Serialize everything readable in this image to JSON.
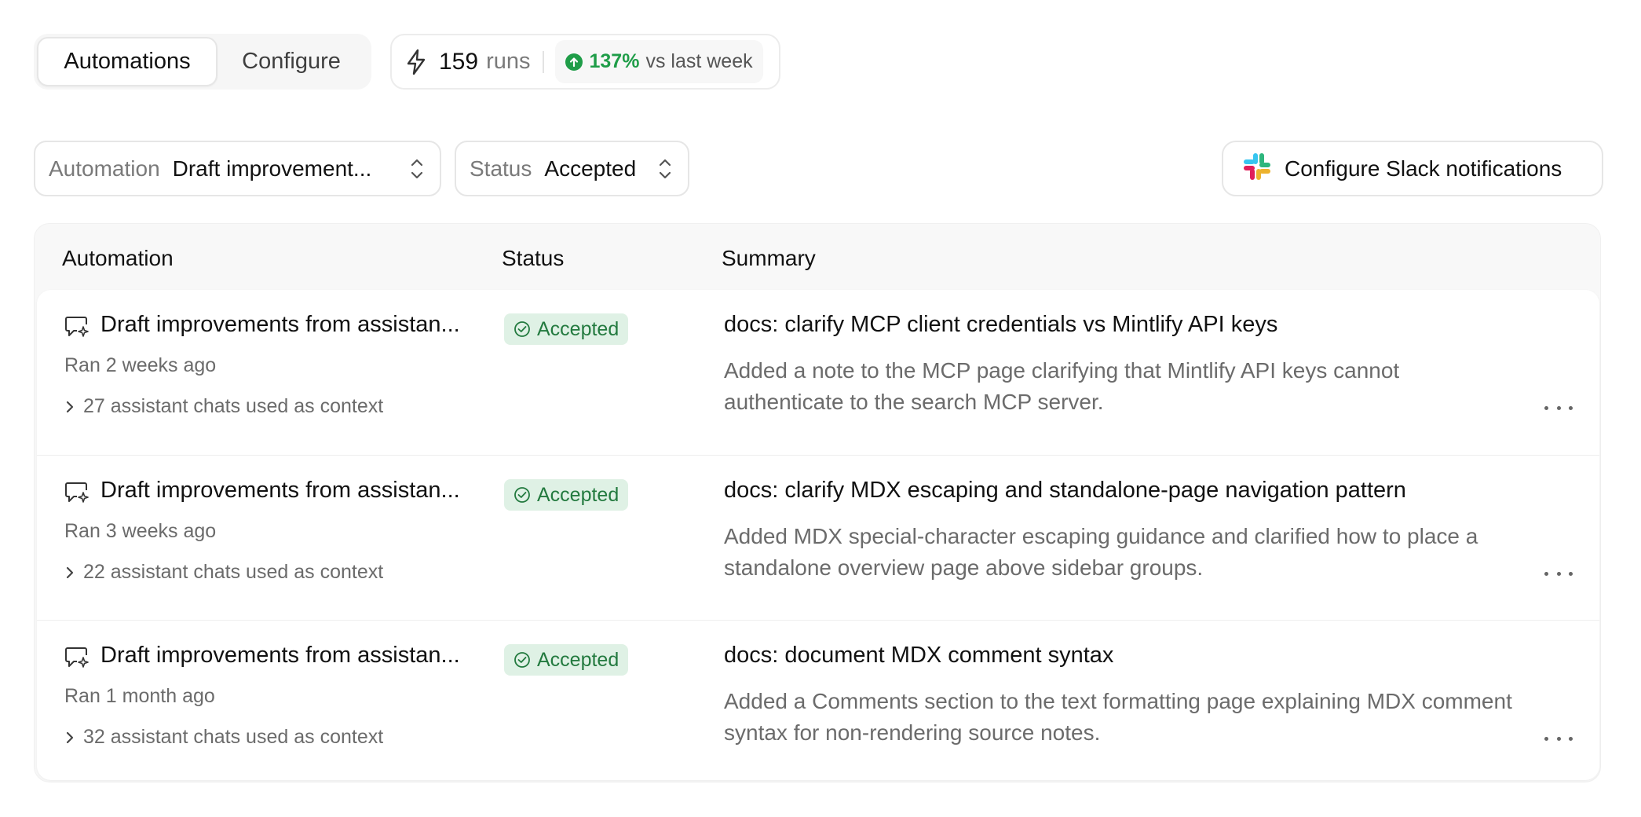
{
  "tabs": [
    {
      "label": "Automations",
      "active": true
    },
    {
      "label": "Configure",
      "active": false
    }
  ],
  "runs": {
    "count": "159",
    "unit": "runs",
    "change": "137%",
    "comparison": "vs last week",
    "trend_color": "#1f9d48"
  },
  "filters": {
    "automation": {
      "label": "Automation",
      "value": "Draft improvement..."
    },
    "status": {
      "label": "Status",
      "value": "Accepted"
    }
  },
  "slack_button": {
    "label": "Configure Slack notifications",
    "icon": "slack-icon"
  },
  "table": {
    "headers": {
      "automation": "Automation",
      "status": "Status",
      "summary": "Summary"
    },
    "rows": [
      {
        "automation": "Draft improvements from assistan...",
        "ran": "Ran 2 weeks ago",
        "context": "27 assistant chats used as context",
        "status": "Accepted",
        "title": "docs: clarify MCP client credentials vs Mintlify API keys",
        "description": "Added a note to the MCP page clarifying that Mintlify API keys cannot authenticate to the search MCP server."
      },
      {
        "automation": "Draft improvements from assistan...",
        "ran": "Ran 3 weeks ago",
        "context": "22 assistant chats used as context",
        "status": "Accepted",
        "title": "docs: clarify MDX escaping and standalone-page navigation pattern",
        "description": "Added MDX special-character escaping guidance and clarified how to place a standalone overview page above sidebar groups."
      },
      {
        "automation": "Draft improvements from assistan...",
        "ran": "Ran 1 month ago",
        "context": "32 assistant chats used as context",
        "status": "Accepted",
        "title": "docs: document MDX comment syntax",
        "description": "Added a Comments section to the text formatting page explaining MDX comment syntax for non-rendering source notes."
      }
    ]
  },
  "colors": {
    "accepted_bg": "#dff1e5",
    "accepted_text": "#237a3f"
  }
}
